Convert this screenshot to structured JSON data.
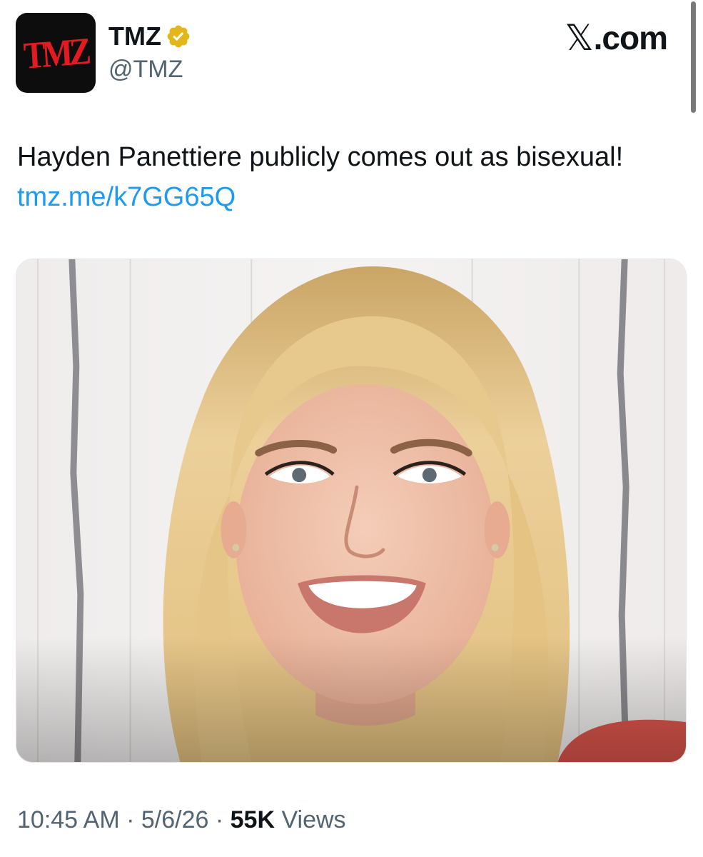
{
  "author": {
    "avatar_text": "TMZ",
    "display_name": "TMZ",
    "handle": "@TMZ",
    "verified_icon": "gold-verified-badge"
  },
  "brand": {
    "x_glyph": "𝕏",
    "text": ".com"
  },
  "tweet": {
    "text": "Hayden Panettiere publicly comes out as bisexual! ",
    "link": "tmz.me/k7GG65Q"
  },
  "meta": {
    "time": "10:45 AM",
    "sep1": " · ",
    "date": "5/6/26",
    "sep2": " · ",
    "views_count": "55K",
    "views_label": " Views"
  },
  "colors": {
    "link": "#1d9bf0",
    "muted": "#536471",
    "verified": "#e2b719",
    "avatar_bg": "#0d0d0d",
    "avatar_text": "#e21b23"
  }
}
